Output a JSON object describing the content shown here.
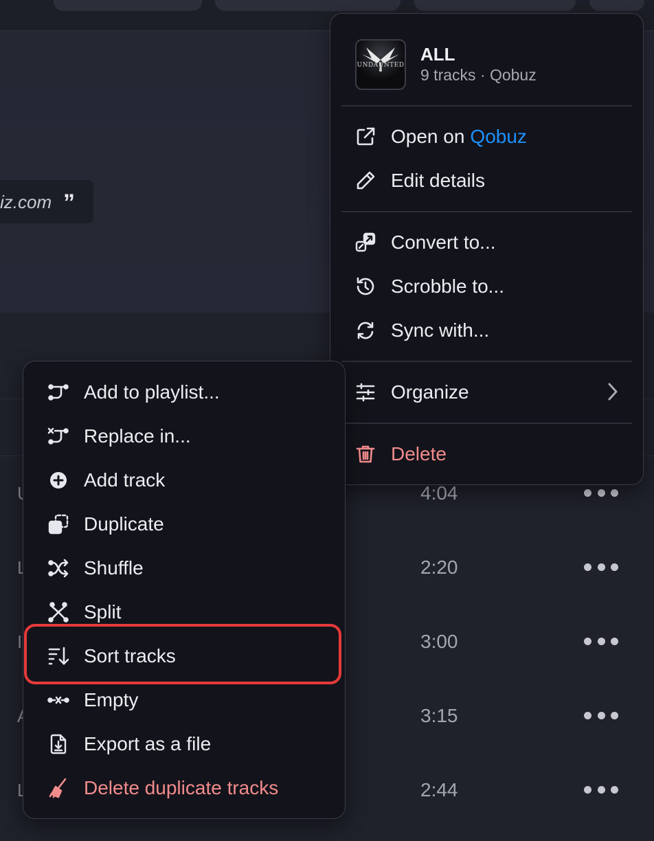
{
  "background": {
    "quote_text": "iz.com",
    "quote_mark": "”",
    "rows": [
      {
        "letter": "U",
        "duration": "4:04"
      },
      {
        "letter": "L",
        "duration": "2:20"
      },
      {
        "letter": "I",
        "duration": "3:00"
      },
      {
        "letter": "A",
        "duration": "3:15"
      },
      {
        "letter": "L",
        "duration": "2:44"
      }
    ]
  },
  "playlist_menu": {
    "header": {
      "title": "ALL",
      "subtitle": "9 tracks · Qobuz",
      "cover_text": "UNDAUNTED"
    },
    "open_on_label": "Open on",
    "open_on_service": "Qobuz",
    "edit_details": "Edit details",
    "convert_to": "Convert to...",
    "scrobble_to": "Scrobble to...",
    "sync_with": "Sync with...",
    "organize": "Organize",
    "delete": "Delete"
  },
  "organize_submenu": {
    "add_to_playlist": "Add to playlist...",
    "replace_in": "Replace in...",
    "add_track": "Add track",
    "duplicate": "Duplicate",
    "shuffle": "Shuffle",
    "split": "Split",
    "sort_tracks": "Sort tracks",
    "empty": "Empty",
    "export_as_file": "Export as a file",
    "delete_duplicates": "Delete duplicate tracks"
  },
  "colors": {
    "accent_link": "#1e90ff",
    "danger": "#f28b8b",
    "highlight_border": "#e63a3a"
  }
}
